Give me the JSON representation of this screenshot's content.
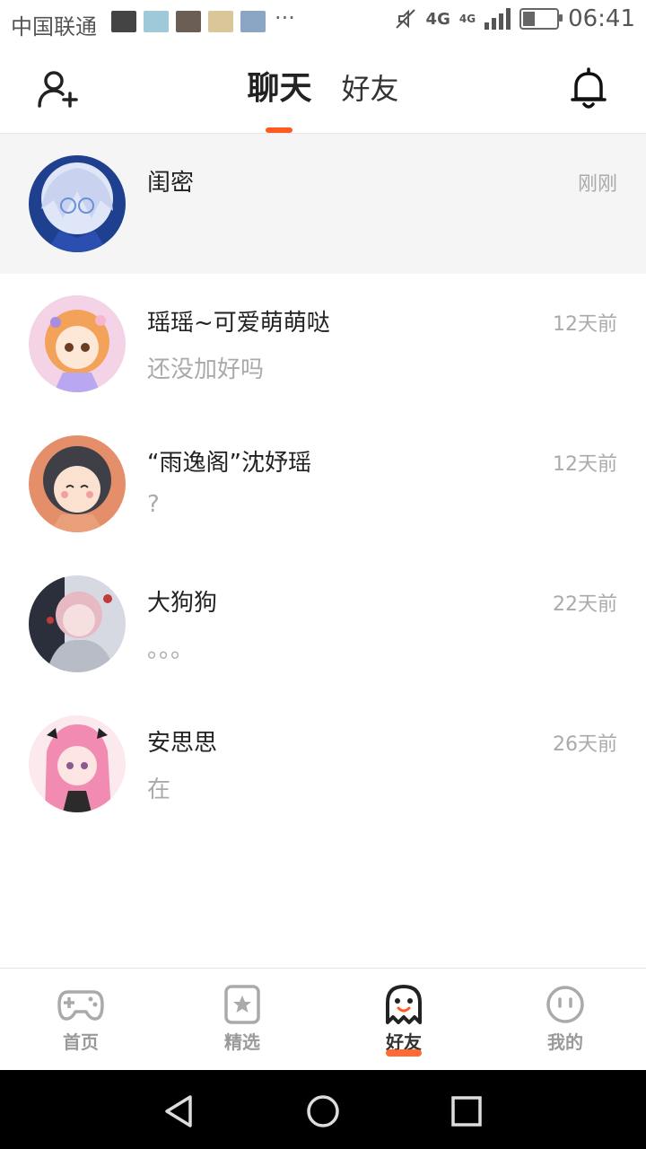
{
  "status_bar": {
    "carrier": "中国联通",
    "more": "···",
    "network": "4G",
    "network_small": "4G",
    "battery_level": 0.35,
    "time": "06:41"
  },
  "header": {
    "tabs": [
      {
        "label": "聊天",
        "active": true
      },
      {
        "label": "好友",
        "active": false
      }
    ],
    "accent_color": "#ff5a1f"
  },
  "chats": [
    {
      "name": "闺密",
      "preview": "",
      "time": "刚刚",
      "highlighted": true
    },
    {
      "name": "瑶瑶~可爱萌萌哒",
      "preview": "还没加好吗",
      "time": "12天前",
      "highlighted": false
    },
    {
      "name": "“雨逸阁”沈妤瑶",
      "preview": "?",
      "time": "12天前",
      "highlighted": false
    },
    {
      "name": "大狗狗",
      "preview": "。。。",
      "time": "22天前",
      "highlighted": false
    },
    {
      "name": "安思思",
      "preview": "在",
      "time": "26天前",
      "highlighted": false
    }
  ],
  "bottom_nav": [
    {
      "label": "首页",
      "icon": "gamepad-icon",
      "active": false
    },
    {
      "label": "精选",
      "icon": "star-box-icon",
      "active": false
    },
    {
      "label": "好友",
      "icon": "ghost-icon",
      "active": true
    },
    {
      "label": "我的",
      "icon": "smiley-icon",
      "active": false
    }
  ],
  "system_nav": [
    "back-icon",
    "home-icon",
    "recents-icon"
  ]
}
